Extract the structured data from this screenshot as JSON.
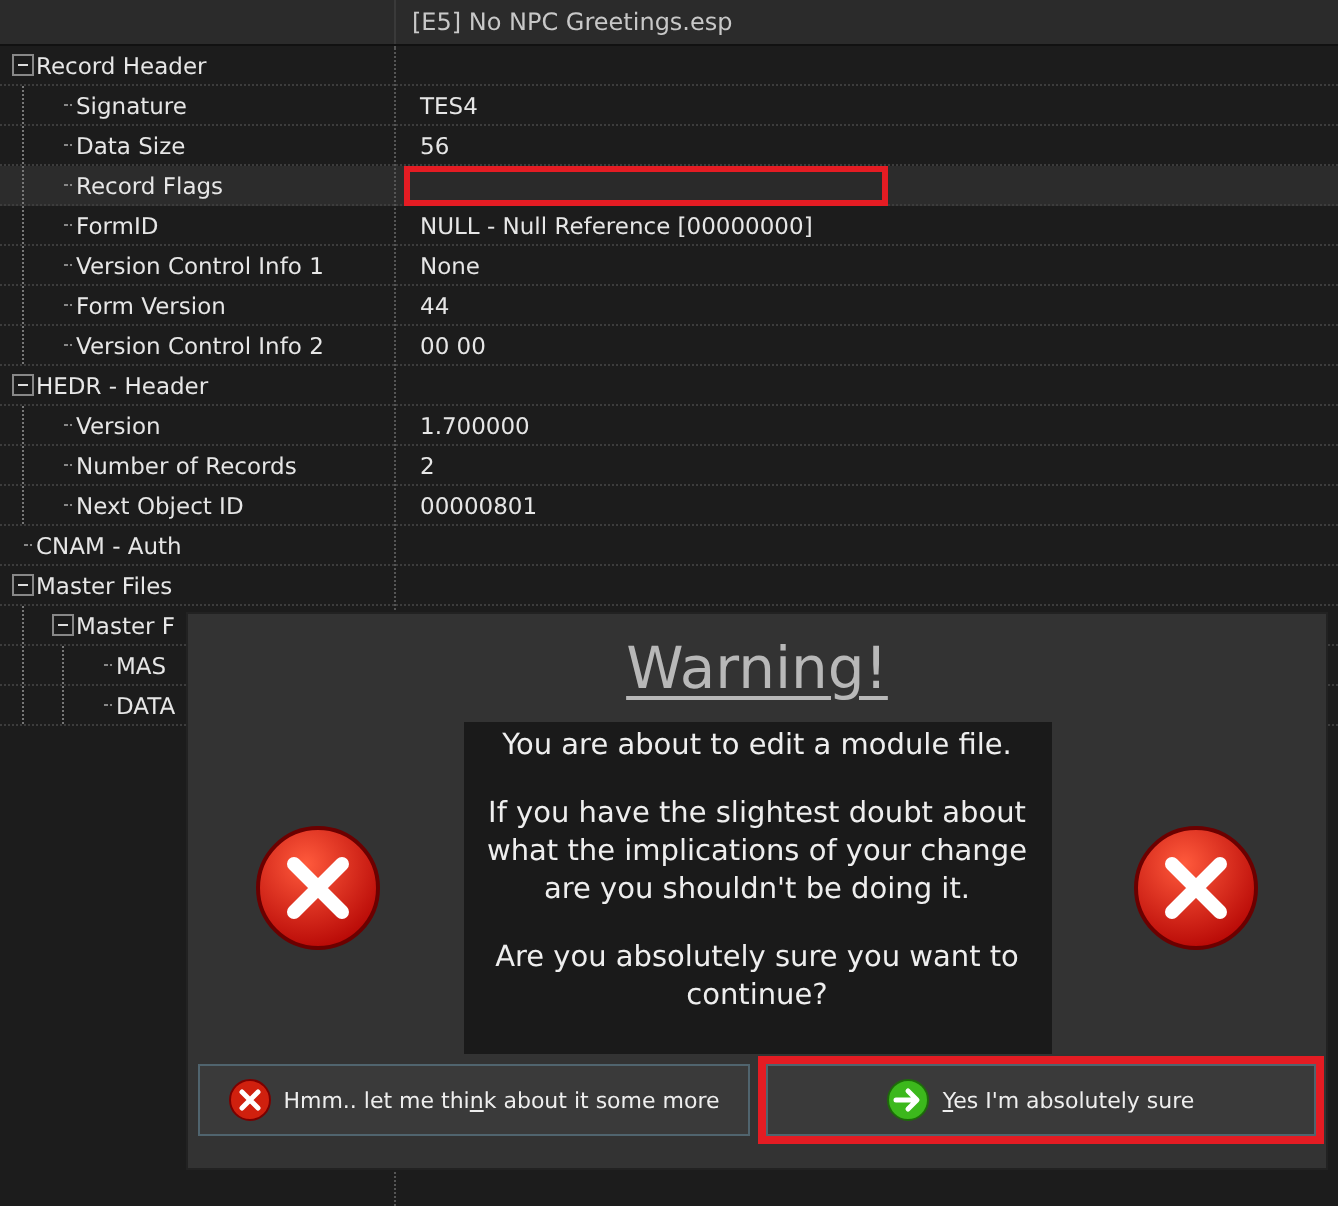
{
  "header": {
    "column_2": "[E5] No NPC Greetings.esp"
  },
  "tree": [
    {
      "label": "Record Header",
      "expanded": true,
      "children": [
        {
          "label": "Signature",
          "value": "TES4"
        },
        {
          "label": "Data Size",
          "value": "56"
        },
        {
          "label": "Record Flags",
          "selected": true,
          "highlighted": true
        },
        {
          "label": "FormID",
          "value": "NULL - Null Reference [00000000]"
        },
        {
          "label": "Version Control Info 1",
          "value": "None"
        },
        {
          "label": "Form Version",
          "value": "44"
        },
        {
          "label": "Version Control Info 2",
          "value": "00 00"
        }
      ]
    },
    {
      "label": "HEDR - Header",
      "expanded": true,
      "children": [
        {
          "label": "Version",
          "value": "1.700000"
        },
        {
          "label": "Number of Records",
          "value": "2"
        },
        {
          "label": "Next Object ID",
          "value": "00000801"
        }
      ]
    },
    {
      "label": "CNAM - Auth"
    },
    {
      "label": "Master Files",
      "expanded": true,
      "children": [
        {
          "label": "Master F",
          "expanded": true,
          "children": [
            {
              "label": "MAS"
            },
            {
              "label": "DATA"
            }
          ]
        }
      ]
    }
  ],
  "dialog": {
    "title": "Warning!",
    "message": [
      "You are about to edit a module file.",
      "If you have the slightest doubt about what the implications of your change are you shouldn't be doing it.",
      "Are you absolutely sure you want to continue?"
    ],
    "buttons": [
      {
        "kind": "cancel",
        "label_before": "Hmm.. let me thi",
        "access_key": "n",
        "label_after": "k about it some more",
        "highlighted": false
      },
      {
        "kind": "confirm",
        "access_key": "Y",
        "label_after": "es I'm absolutely sure",
        "highlighted": true
      }
    ]
  }
}
